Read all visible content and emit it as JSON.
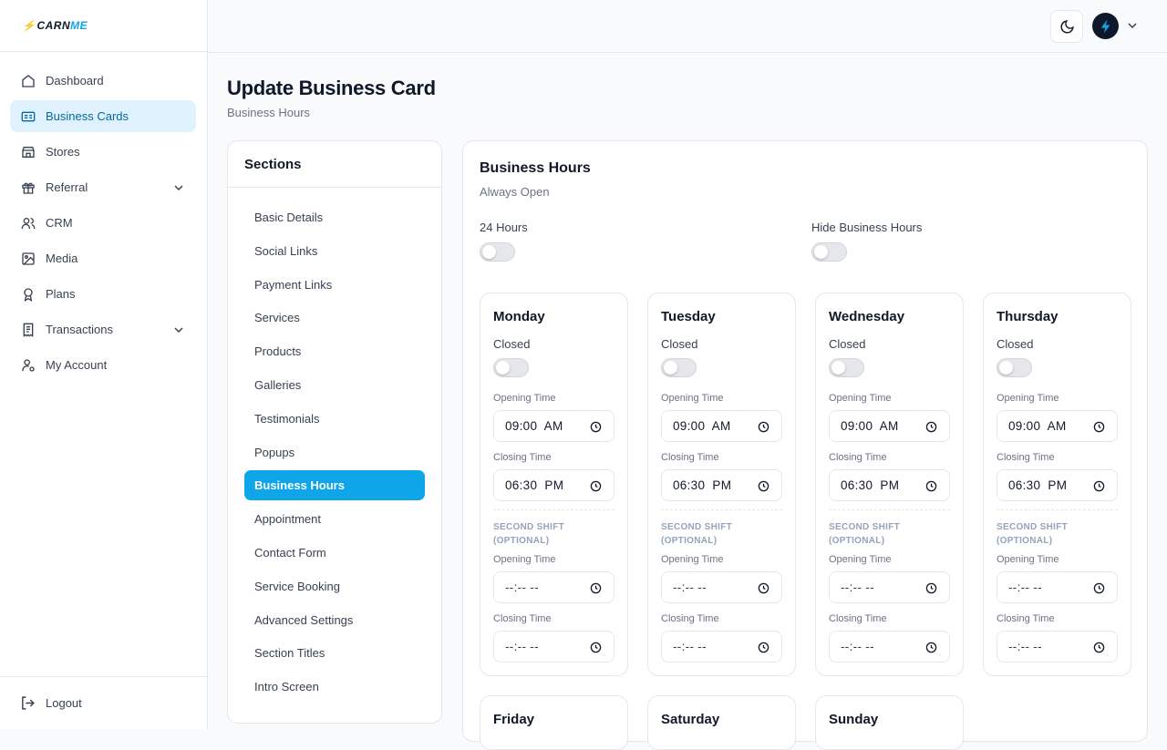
{
  "brand": {
    "logo_text_left": "CARN",
    "logo_text_right": "ME"
  },
  "sidebar": {
    "items": [
      {
        "label": "Dashboard",
        "icon": "home-icon"
      },
      {
        "label": "Business Cards",
        "icon": "id-card-icon",
        "active": true
      },
      {
        "label": "Stores",
        "icon": "store-icon"
      },
      {
        "label": "Referral",
        "icon": "gift-icon",
        "has_submenu": true
      },
      {
        "label": "CRM",
        "icon": "users-icon"
      },
      {
        "label": "Media",
        "icon": "image-icon"
      },
      {
        "label": "Plans",
        "icon": "award-icon"
      },
      {
        "label": "Transactions",
        "icon": "receipt-icon",
        "has_submenu": true
      },
      {
        "label": "My Account",
        "icon": "user-cog-icon"
      }
    ],
    "logout_label": "Logout"
  },
  "topbar": {
    "theme_icon": "moon-icon",
    "avatar_icon": "bolt-icon"
  },
  "page": {
    "title": "Update Business Card",
    "subtitle": "Business Hours"
  },
  "sections": {
    "title": "Sections",
    "items": [
      "Basic Details",
      "Social Links",
      "Payment Links",
      "Services",
      "Products",
      "Galleries",
      "Testimonials",
      "Popups",
      "Business Hours",
      "Appointment",
      "Contact Form",
      "Service Booking",
      "Advanced Settings",
      "Section Titles",
      "Intro Screen"
    ],
    "active": "Business Hours"
  },
  "hours": {
    "title": "Business Hours",
    "subtitle": "Always Open",
    "toggle_24h_label": "24 Hours",
    "toggle_hide_label": "Hide Business Hours",
    "closed_label": "Closed",
    "opening_label": "Opening Time",
    "closing_label": "Closing Time",
    "second_shift_label": "SECOND SHIFT (OPTIONAL)",
    "days": [
      {
        "name": "Monday",
        "open": "09:00  AM",
        "close": "06:30  PM",
        "open2": "--:-- --",
        "close2": "--:-- --"
      },
      {
        "name": "Tuesday",
        "open": "09:00  AM",
        "close": "06:30  PM",
        "open2": "--:-- --",
        "close2": "--:-- --"
      },
      {
        "name": "Wednesday",
        "open": "09:00  AM",
        "close": "06:30  PM",
        "open2": "--:-- --",
        "close2": "--:-- --"
      },
      {
        "name": "Thursday",
        "open": "09:00  AM",
        "close": "06:30  PM",
        "open2": "--:-- --",
        "close2": "--:-- --"
      },
      {
        "name": "Friday"
      },
      {
        "name": "Saturday"
      },
      {
        "name": "Sunday"
      }
    ]
  },
  "colors": {
    "accent": "#0ea5e9",
    "active_nav_bg": "#e0f2fe"
  }
}
